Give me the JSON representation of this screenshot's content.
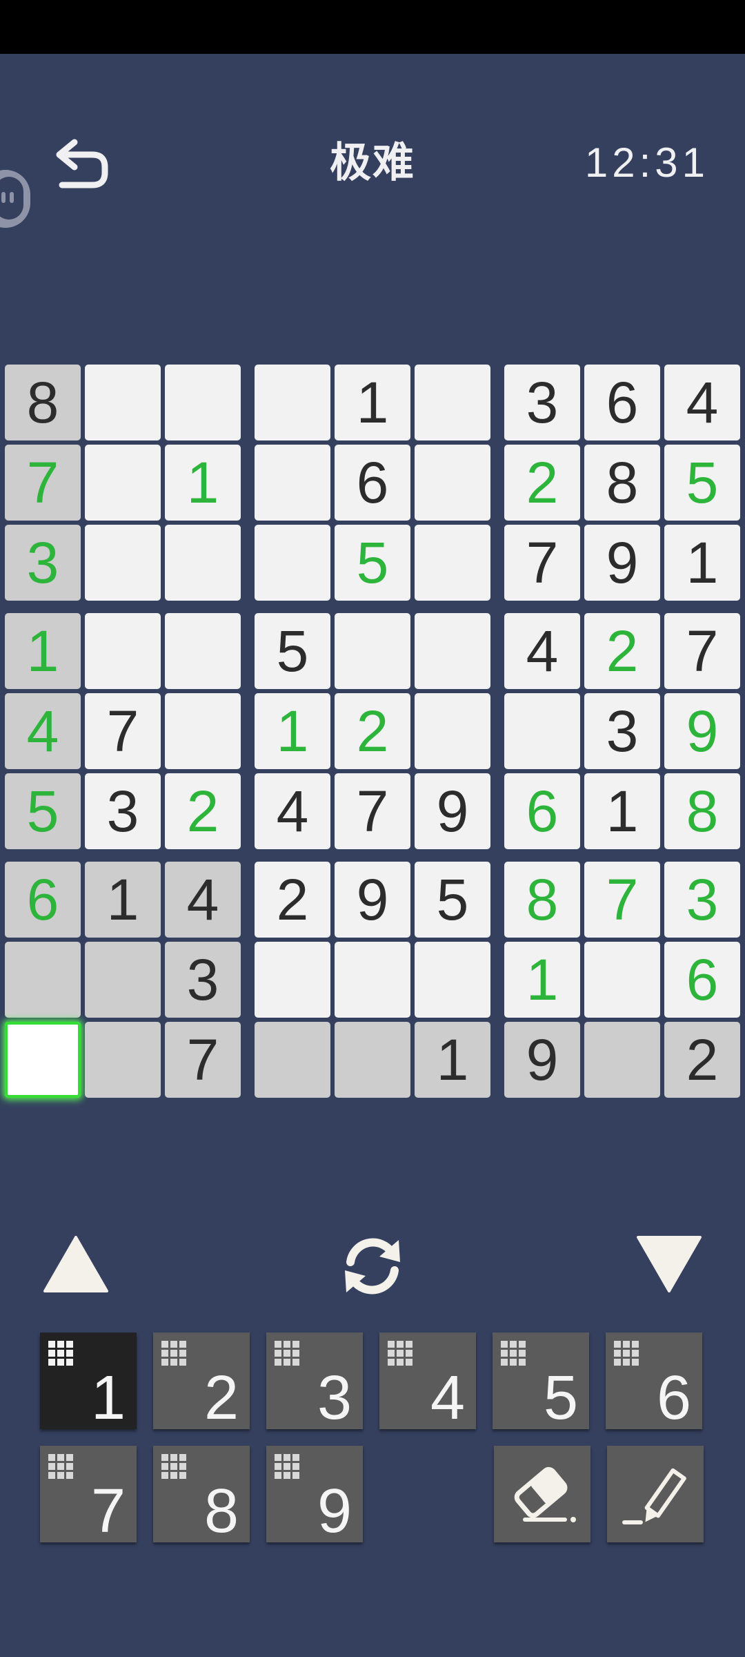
{
  "header": {
    "title": "极难",
    "timer": "12:31"
  },
  "board": {
    "rows": [
      [
        {
          "v": "8",
          "t": "given",
          "bg": "shaded"
        },
        {
          "v": "",
          "bg": "white"
        },
        {
          "v": "",
          "bg": "white"
        },
        {
          "v": "",
          "bg": "white"
        },
        {
          "v": "1",
          "t": "given",
          "bg": "white"
        },
        {
          "v": "",
          "bg": "white"
        },
        {
          "v": "3",
          "t": "given",
          "bg": "white"
        },
        {
          "v": "6",
          "t": "given",
          "bg": "white"
        },
        {
          "v": "4",
          "t": "given",
          "bg": "white"
        }
      ],
      [
        {
          "v": "7",
          "t": "user",
          "bg": "shaded"
        },
        {
          "v": "",
          "bg": "white"
        },
        {
          "v": "1",
          "t": "user",
          "bg": "white"
        },
        {
          "v": "",
          "bg": "white"
        },
        {
          "v": "6",
          "t": "given",
          "bg": "white"
        },
        {
          "v": "",
          "bg": "white"
        },
        {
          "v": "2",
          "t": "user",
          "bg": "white"
        },
        {
          "v": "8",
          "t": "given",
          "bg": "white"
        },
        {
          "v": "5",
          "t": "user",
          "bg": "white"
        }
      ],
      [
        {
          "v": "3",
          "t": "user",
          "bg": "shaded"
        },
        {
          "v": "",
          "bg": "white"
        },
        {
          "v": "",
          "bg": "white"
        },
        {
          "v": "",
          "bg": "white"
        },
        {
          "v": "5",
          "t": "user",
          "bg": "white"
        },
        {
          "v": "",
          "bg": "white"
        },
        {
          "v": "7",
          "t": "given",
          "bg": "white"
        },
        {
          "v": "9",
          "t": "given",
          "bg": "white"
        },
        {
          "v": "1",
          "t": "given",
          "bg": "white"
        }
      ],
      [
        {
          "v": "1",
          "t": "user",
          "bg": "shaded"
        },
        {
          "v": "",
          "bg": "white"
        },
        {
          "v": "",
          "bg": "white"
        },
        {
          "v": "5",
          "t": "given",
          "bg": "white"
        },
        {
          "v": "",
          "bg": "white"
        },
        {
          "v": "",
          "bg": "white"
        },
        {
          "v": "4",
          "t": "given",
          "bg": "white"
        },
        {
          "v": "2",
          "t": "user",
          "bg": "white"
        },
        {
          "v": "7",
          "t": "given",
          "bg": "white"
        }
      ],
      [
        {
          "v": "4",
          "t": "user",
          "bg": "shaded"
        },
        {
          "v": "7",
          "t": "given",
          "bg": "white"
        },
        {
          "v": "",
          "bg": "white"
        },
        {
          "v": "1",
          "t": "user",
          "bg": "white"
        },
        {
          "v": "2",
          "t": "user",
          "bg": "white"
        },
        {
          "v": "",
          "bg": "white"
        },
        {
          "v": "",
          "bg": "white"
        },
        {
          "v": "3",
          "t": "given",
          "bg": "white"
        },
        {
          "v": "9",
          "t": "user",
          "bg": "white"
        }
      ],
      [
        {
          "v": "5",
          "t": "user",
          "bg": "shaded"
        },
        {
          "v": "3",
          "t": "given",
          "bg": "white"
        },
        {
          "v": "2",
          "t": "user",
          "bg": "white"
        },
        {
          "v": "4",
          "t": "given",
          "bg": "white"
        },
        {
          "v": "7",
          "t": "given",
          "bg": "white"
        },
        {
          "v": "9",
          "t": "given",
          "bg": "white"
        },
        {
          "v": "6",
          "t": "user",
          "bg": "white"
        },
        {
          "v": "1",
          "t": "given",
          "bg": "white"
        },
        {
          "v": "8",
          "t": "user",
          "bg": "white"
        }
      ],
      [
        {
          "v": "6",
          "t": "user",
          "bg": "shaded"
        },
        {
          "v": "1",
          "t": "given",
          "bg": "shaded"
        },
        {
          "v": "4",
          "t": "given",
          "bg": "shaded"
        },
        {
          "v": "2",
          "t": "given",
          "bg": "white"
        },
        {
          "v": "9",
          "t": "given",
          "bg": "white"
        },
        {
          "v": "5",
          "t": "given",
          "bg": "white"
        },
        {
          "v": "8",
          "t": "user",
          "bg": "white"
        },
        {
          "v": "7",
          "t": "user",
          "bg": "white"
        },
        {
          "v": "3",
          "t": "user",
          "bg": "white"
        }
      ],
      [
        {
          "v": "",
          "bg": "shaded"
        },
        {
          "v": "",
          "bg": "shaded"
        },
        {
          "v": "3",
          "t": "given",
          "bg": "shaded"
        },
        {
          "v": "",
          "bg": "white"
        },
        {
          "v": "",
          "bg": "white"
        },
        {
          "v": "",
          "bg": "white"
        },
        {
          "v": "1",
          "t": "user",
          "bg": "white"
        },
        {
          "v": "",
          "bg": "white"
        },
        {
          "v": "6",
          "t": "user",
          "bg": "white"
        }
      ],
      [
        {
          "v": "",
          "bg": "selected"
        },
        {
          "v": "",
          "bg": "shaded"
        },
        {
          "v": "7",
          "t": "given",
          "bg": "shaded"
        },
        {
          "v": "",
          "bg": "shaded"
        },
        {
          "v": "",
          "bg": "shaded"
        },
        {
          "v": "1",
          "t": "given",
          "bg": "shaded"
        },
        {
          "v": "9",
          "t": "given",
          "bg": "shaded"
        },
        {
          "v": "",
          "bg": "shaded"
        },
        {
          "v": "2",
          "t": "given",
          "bg": "shaded"
        }
      ]
    ]
  },
  "controls": {
    "up_icon": "triangle-up-icon",
    "refresh_icon": "refresh-icon",
    "down_icon": "triangle-down-icon"
  },
  "numpad": [
    {
      "label": "1",
      "active": true
    },
    {
      "label": "2",
      "active": false
    },
    {
      "label": "3",
      "active": false
    },
    {
      "label": "4",
      "active": false
    },
    {
      "label": "5",
      "active": false
    },
    {
      "label": "6",
      "active": false
    },
    {
      "label": "7",
      "active": false
    },
    {
      "label": "8",
      "active": false
    },
    {
      "label": "9",
      "active": false
    }
  ],
  "tools": {
    "erase_icon": "eraser-icon",
    "pencil_icon": "pencil-icon"
  },
  "colors": {
    "background": "#35405f",
    "given_digit": "#2c2c2c",
    "user_digit": "#2db43a",
    "cell_white": "#f2f2f2",
    "cell_shaded": "#cdcdcd",
    "selected_glow": "#33dd33",
    "numpad_button": "#5b5b5b",
    "numpad_active": "#222222"
  }
}
